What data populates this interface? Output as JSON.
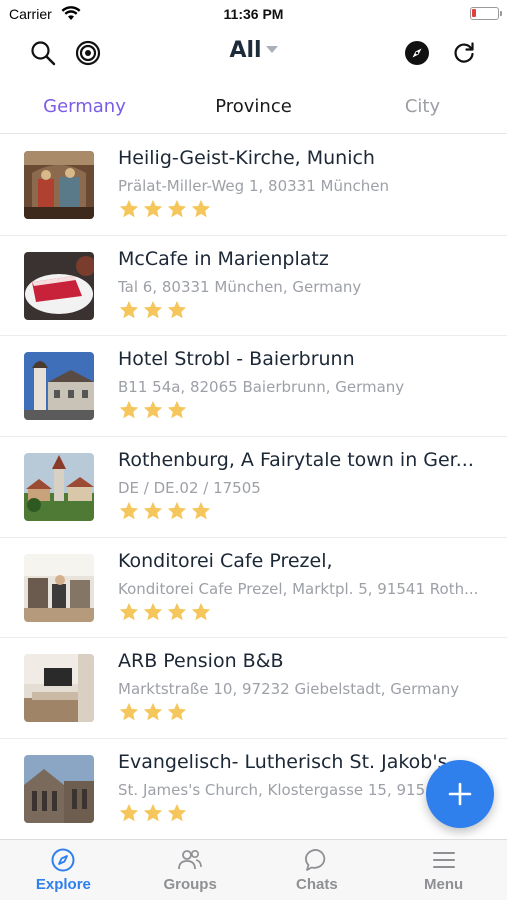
{
  "status_bar": {
    "carrier": "Carrier",
    "time": "11:36 PM",
    "battery_color": "#e0413a"
  },
  "top_bar": {
    "filter_label": "All",
    "icons": [
      "search-icon",
      "target-icon",
      "compass-icon",
      "refresh-icon"
    ]
  },
  "tabs": [
    {
      "label": "Germany",
      "active": true
    },
    {
      "label": "Province",
      "active": false
    },
    {
      "label": "City",
      "active": false
    }
  ],
  "places": [
    {
      "title": "Heilig-Geist-Kirche, Munich",
      "address": "Prälat-Miller-Weg 1, 80331 München",
      "rating": 4,
      "thumb": "church-interior"
    },
    {
      "title": "McCafe in Marienplatz",
      "address": "Tal 6, 80331 München, Germany",
      "rating": 3,
      "thumb": "cake"
    },
    {
      "title": "Hotel Strobl - Baierbrunn",
      "address": "B11 54a, 82065 Baierbrunn, Germany",
      "rating": 3,
      "thumb": "building-tower"
    },
    {
      "title": "Rothenburg, A Fairytale town in Ger...",
      "address": "DE / DE.02 / 17505",
      "rating": 4,
      "thumb": "town-tower"
    },
    {
      "title": "Konditorei Cafe Prezel,",
      "address": "Konditorei Cafe Prezel, Marktpl. 5, 91541 Roth...",
      "rating": 4,
      "thumb": "cafe-interior"
    },
    {
      "title": "ARB Pension B&B",
      "address": "Marktstraße 10, 97232 Giebelstadt, Germany",
      "rating": 3,
      "thumb": "room"
    },
    {
      "title": "Evangelisch- Lutherisch St. Jakob's K...",
      "address": "St. James's Church, Klostergasse 15, 915...",
      "rating": 3,
      "thumb": "church-exterior"
    }
  ],
  "bottom_nav": [
    {
      "label": "Explore",
      "icon": "compass-icon",
      "active": true
    },
    {
      "label": "Groups",
      "icon": "people-icon",
      "active": false
    },
    {
      "label": "Chats",
      "icon": "chat-bubble-icon",
      "active": false
    },
    {
      "label": "Menu",
      "icon": "menu-icon",
      "active": false
    }
  ],
  "colors": {
    "accent": "#7b5ce6",
    "primary_blue": "#2f80ed",
    "star": "#f5c65b"
  }
}
